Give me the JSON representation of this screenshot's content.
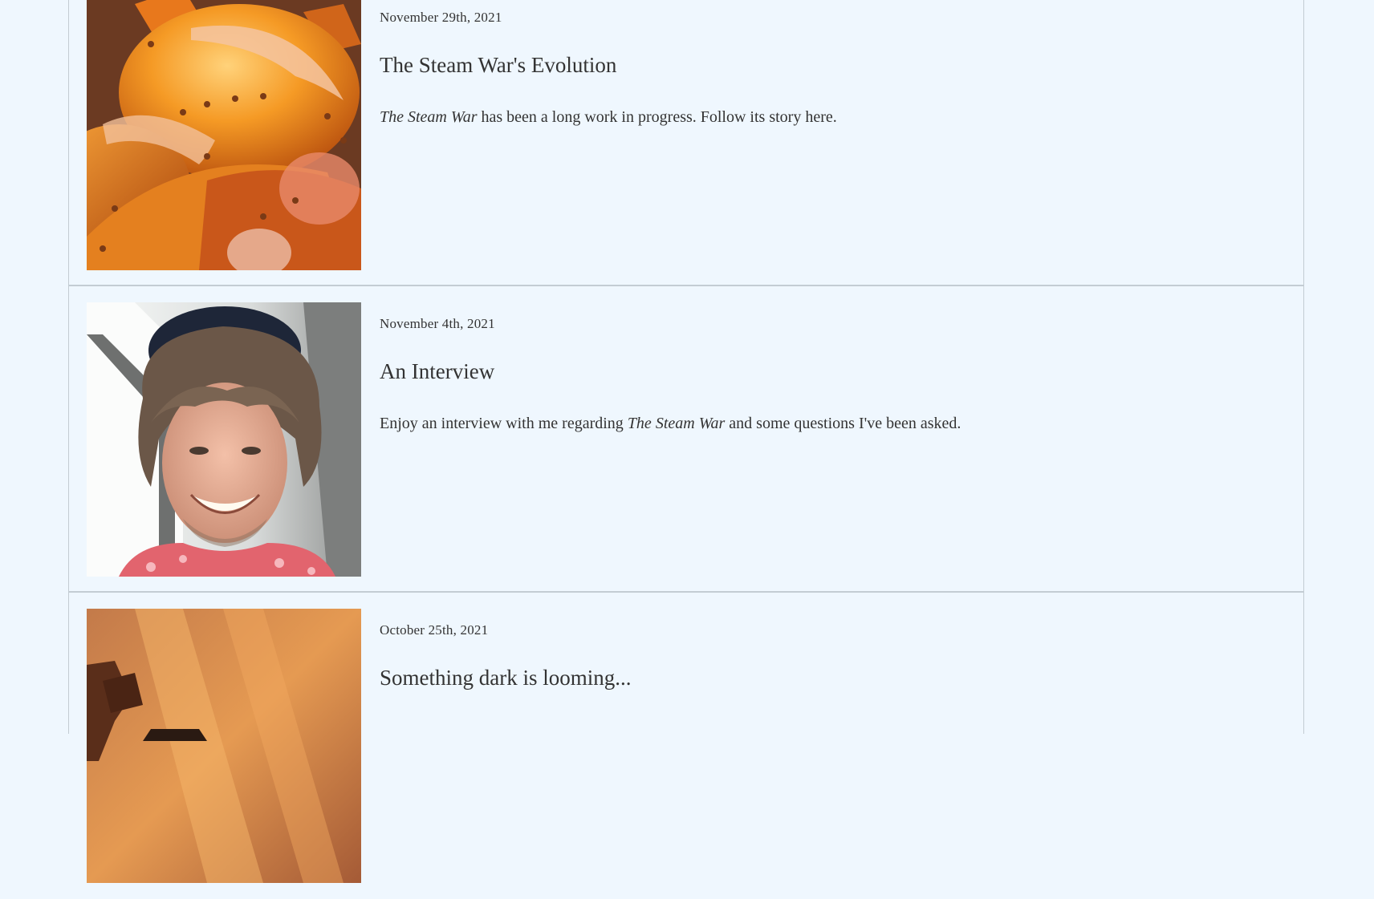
{
  "posts": [
    {
      "date": "November 29th, 2021",
      "title": "The Steam War's Evolution",
      "excerpt_italic_lead": "The Steam War",
      "excerpt_rest": " has been a long work in progress. Follow its story here.",
      "image": "orange-mech-armor-art"
    },
    {
      "date": "November 4th, 2021",
      "title": "An Interview",
      "excerpt_pre": "Enjoy an interview with me regarding ",
      "excerpt_italic": "The Steam War",
      "excerpt_post": " and some questions I've been asked.",
      "image": "author-portrait-photo"
    },
    {
      "date": "October 25th, 2021",
      "title": "Something dark is looming...",
      "image": "dark-gear-teaser-art"
    }
  ],
  "colors": {
    "page_background": "#eff7fe",
    "divider": "#c3ccd3",
    "text": "#333333"
  }
}
